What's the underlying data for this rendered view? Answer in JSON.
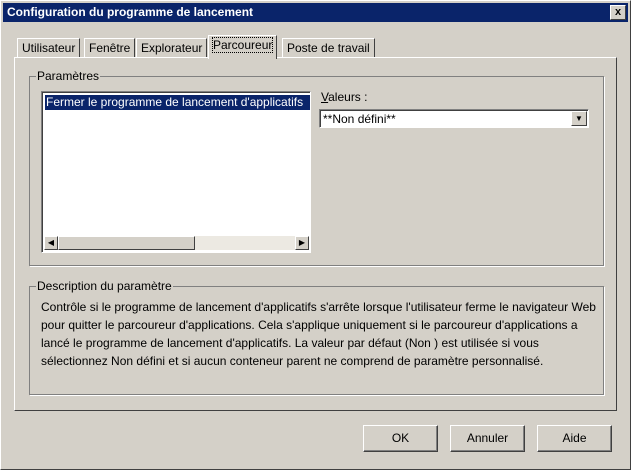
{
  "window": {
    "title": "Configuration du programme de lancement",
    "close_label": "x"
  },
  "tabs": [
    {
      "label": "Utilisateur"
    },
    {
      "label": "Fenêtre"
    },
    {
      "label": "Explorateur"
    },
    {
      "label": "Parcoureur"
    },
    {
      "label": "Poste de travail"
    }
  ],
  "active_tab": "Parcoureur",
  "params": {
    "group_label": "Paramètres",
    "items": [
      {
        "label": "Fermer le programme de lancement d'applicatifs"
      }
    ],
    "selected_index": 0
  },
  "valeurs": {
    "label_prefix": "V",
    "label_rest": "aleurs :",
    "selected": "**Non défini**"
  },
  "description": {
    "group_label": "Description du paramètre",
    "text": "Contrôle si le programme de lancement d'applicatifs s'arrête lorsque l'utilisateur ferme le navigateur Web pour quitter le parcoureur d'applications. Cela s'applique uniquement si le parcoureur d'applications a lancé le programme de lancement d'applicatifs. La valeur par défaut (Non ) est utilisée si vous sélectionnez Non défini et si aucun conteneur parent ne comprend de paramètre personnalisé."
  },
  "buttons": {
    "ok": "OK",
    "cancel": "Annuler",
    "help": "Aide"
  }
}
